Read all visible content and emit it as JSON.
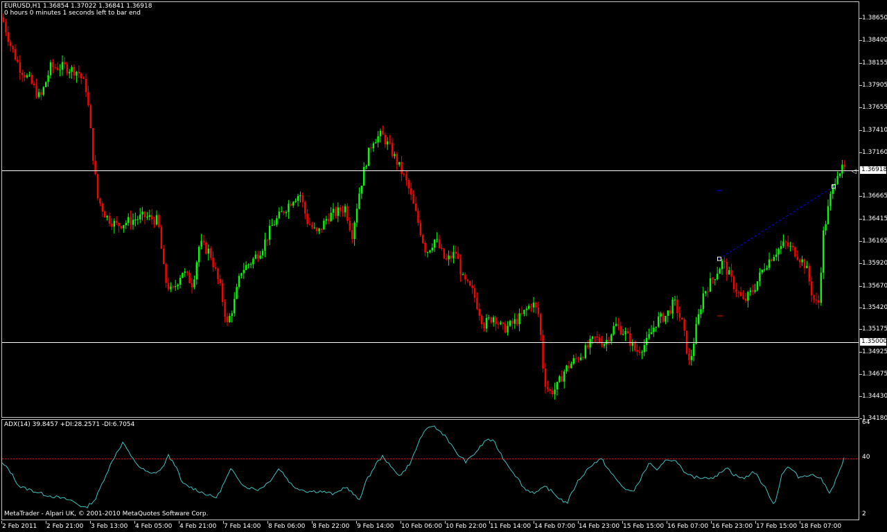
{
  "symbol_header": "EURUSD,H1  1.36854 1.37022 1.36841 1.36918",
  "timer_text": "0 hours 0 minutes 1 seconds left to bar end",
  "indicator_header": "ADX(14) 39.8457 +DI:28.2571 -DI:6.7054",
  "copyright": "MetaTrader - Alpari UK, © 2001-2010 MetaQuotes Software Corp.",
  "current_price": "1.36918",
  "level_line_price": "1.35000",
  "price_scale": [
    "1.38650",
    "1.38400",
    "1.38155",
    "1.37905",
    "1.37655",
    "1.37410",
    "1.37160",
    "1.36665",
    "1.36415",
    "1.36165",
    "1.35920",
    "1.35670",
    "1.35420",
    "1.35175",
    "1.34925",
    "1.34675",
    "1.34430",
    "1.34180"
  ],
  "indicator_scale": [
    "64",
    "40",
    "2"
  ],
  "indicator_level": 40,
  "time_labels": [
    "2 Feb 2011",
    "2 Feb 21:00",
    "3 Feb 13:00",
    "4 Feb 05:00",
    "4 Feb 21:00",
    "7 Feb 14:00",
    "8 Feb 06:00",
    "8 Feb 22:00",
    "9 Feb 14:00",
    "10 Feb 06:00",
    "10 Feb 22:00",
    "11 Feb 14:00",
    "14 Feb 07:00",
    "14 Feb 23:00",
    "15 Feb 15:00",
    "16 Feb 07:00",
    "16 Feb 23:00",
    "17 Feb 15:00",
    "18 Feb 07:00"
  ],
  "colors": {
    "background": "#000000",
    "bull": "#00ff00",
    "bear": "#ff0000",
    "adx": "#40c0c0",
    "level": "#ff0000",
    "trendline": "#0000ff"
  },
  "chart_data": [
    {
      "type": "candlestick",
      "title": "EURUSD,H1",
      "ylim": [
        1.3418,
        1.3877
      ],
      "key_prices": {
        "start_high": 1.386,
        "low_feb14": 1.343,
        "high_feb9": 1.3742,
        "last": 1.36918
      },
      "horizontal_levels": [
        1.36918,
        1.35
      ],
      "path": [
        [
          0,
          1.386
        ],
        [
          12,
          1.383
        ],
        [
          25,
          1.3805
        ],
        [
          40,
          1.379
        ],
        [
          55,
          1.377
        ],
        [
          70,
          1.3805
        ],
        [
          90,
          1.3805
        ],
        [
          110,
          1.38
        ],
        [
          122,
          1.378
        ],
        [
          132,
          1.37
        ],
        [
          138,
          1.366
        ],
        [
          150,
          1.364
        ],
        [
          165,
          1.363
        ],
        [
          185,
          1.3635
        ],
        [
          205,
          1.364
        ],
        [
          225,
          1.3635
        ],
        [
          235,
          1.357
        ],
        [
          245,
          1.3555
        ],
        [
          260,
          1.358
        ],
        [
          275,
          1.3565
        ],
        [
          285,
          1.361
        ],
        [
          300,
          1.36
        ],
        [
          315,
          1.356
        ],
        [
          325,
          1.352
        ],
        [
          335,
          1.3545
        ],
        [
          345,
          1.358
        ],
        [
          360,
          1.359
        ],
        [
          375,
          1.3605
        ],
        [
          390,
          1.363
        ],
        [
          405,
          1.3645
        ],
        [
          420,
          1.366
        ],
        [
          430,
          1.3665
        ],
        [
          440,
          1.3635
        ],
        [
          455,
          1.362
        ],
        [
          470,
          1.364
        ],
        [
          485,
          1.3645
        ],
        [
          495,
          1.365
        ],
        [
          505,
          1.362
        ],
        [
          515,
          1.3665
        ],
        [
          525,
          1.37
        ],
        [
          535,
          1.3725
        ],
        [
          548,
          1.373
        ],
        [
          560,
          1.3715
        ],
        [
          570,
          1.37
        ],
        [
          585,
          1.3675
        ],
        [
          598,
          1.364
        ],
        [
          612,
          1.36
        ],
        [
          625,
          1.3615
        ],
        [
          640,
          1.359
        ],
        [
          655,
          1.36
        ],
        [
          665,
          1.357
        ],
        [
          680,
          1.3555
        ],
        [
          695,
          1.352
        ],
        [
          710,
          1.353
        ],
        [
          722,
          1.3515
        ],
        [
          735,
          1.352
        ],
        [
          750,
          1.353
        ],
        [
          765,
          1.3545
        ],
        [
          775,
          1.353
        ],
        [
          782,
          1.346
        ],
        [
          790,
          1.3445
        ],
        [
          800,
          1.345
        ],
        [
          812,
          1.347
        ],
        [
          825,
          1.348
        ],
        [
          840,
          1.349
        ],
        [
          855,
          1.3505
        ],
        [
          870,
          1.35
        ],
        [
          885,
          1.352
        ],
        [
          900,
          1.351
        ],
        [
          915,
          1.349
        ],
        [
          930,
          1.35
        ],
        [
          945,
          1.3525
        ],
        [
          958,
          1.353
        ],
        [
          970,
          1.3545
        ],
        [
          982,
          1.352
        ],
        [
          992,
          1.3475
        ],
        [
          1000,
          1.351
        ],
        [
          1012,
          1.3555
        ],
        [
          1025,
          1.357
        ],
        [
          1040,
          1.359
        ],
        [
          1055,
          1.3565
        ],
        [
          1070,
          1.3545
        ],
        [
          1085,
          1.356
        ],
        [
          1100,
          1.3585
        ],
        [
          1115,
          1.36
        ],
        [
          1130,
          1.361
        ],
        [
          1145,
          1.36
        ],
        [
          1160,
          1.3585
        ],
        [
          1170,
          1.355
        ],
        [
          1178,
          1.354
        ],
        [
          1185,
          1.362
        ],
        [
          1195,
          1.366
        ],
        [
          1205,
          1.369
        ],
        [
          1215,
          1.36918
        ]
      ],
      "trendline": {
        "from": [
          1035,
          1.3593
        ],
        "to": [
          1200,
          1.3673
        ],
        "style": "dashed"
      }
    },
    {
      "type": "line",
      "title": "ADX(14)",
      "series": [
        {
          "name": "ADX(14)",
          "values_path": [
            [
              0,
              37
            ],
            [
              10,
              33
            ],
            [
              25,
              22
            ],
            [
              40,
              20
            ],
            [
              60,
              17
            ],
            [
              80,
              15
            ],
            [
              100,
              13
            ],
            [
              120,
              8
            ],
            [
              135,
              14
            ],
            [
              150,
              30
            ],
            [
              165,
              44
            ],
            [
              175,
              51
            ],
            [
              185,
              42
            ],
            [
              200,
              34
            ],
            [
              215,
              30
            ],
            [
              230,
              33
            ],
            [
              240,
              42
            ],
            [
              250,
              36
            ],
            [
              260,
              24
            ],
            [
              280,
              20
            ],
            [
              300,
              16
            ],
            [
              310,
              15
            ],
            [
              320,
              24
            ],
            [
              330,
              33
            ],
            [
              340,
              28
            ],
            [
              350,
              22
            ],
            [
              370,
              20
            ],
            [
              385,
              25
            ],
            [
              400,
              34
            ],
            [
              410,
              28
            ],
            [
              420,
              22
            ],
            [
              440,
              19
            ],
            [
              460,
              19
            ],
            [
              480,
              17
            ],
            [
              495,
              22
            ],
            [
              505,
              18
            ],
            [
              515,
              13
            ],
            [
              525,
              25
            ],
            [
              540,
              37
            ],
            [
              550,
              42
            ],
            [
              560,
              35
            ],
            [
              575,
              29
            ],
            [
              590,
              38
            ],
            [
              605,
              55
            ],
            [
              620,
              62
            ],
            [
              640,
              55
            ],
            [
              655,
              44
            ],
            [
              670,
              38
            ],
            [
              685,
              45
            ],
            [
              700,
              53
            ],
            [
              710,
              51
            ],
            [
              725,
              39
            ],
            [
              740,
              30
            ],
            [
              755,
              20
            ],
            [
              770,
              18
            ],
            [
              785,
              22
            ],
            [
              800,
              16
            ],
            [
              815,
              11
            ],
            [
              830,
              25
            ],
            [
              850,
              36
            ],
            [
              865,
              40
            ],
            [
              880,
              30
            ],
            [
              895,
              22
            ],
            [
              910,
              18
            ],
            [
              925,
              30
            ],
            [
              935,
              38
            ],
            [
              945,
              32
            ],
            [
              960,
              40
            ],
            [
              975,
              38
            ],
            [
              985,
              30
            ],
            [
              1000,
              28
            ],
            [
              1015,
              28
            ],
            [
              1030,
              28
            ],
            [
              1045,
              35
            ],
            [
              1055,
              30
            ],
            [
              1070,
              27
            ],
            [
              1085,
              32
            ],
            [
              1100,
              22
            ],
            [
              1115,
              10
            ],
            [
              1125,
              30
            ],
            [
              1135,
              35
            ],
            [
              1150,
              28
            ],
            [
              1165,
              30
            ],
            [
              1180,
              28
            ],
            [
              1195,
              18
            ],
            [
              1205,
              28
            ],
            [
              1215,
              40
            ]
          ]
        }
      ],
      "ylim": [
        2,
        64
      ],
      "level": 40
    }
  ]
}
